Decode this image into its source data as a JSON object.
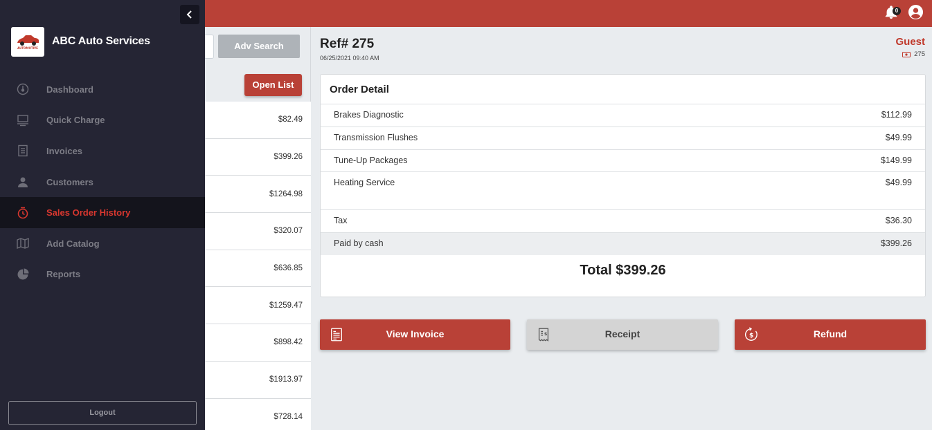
{
  "topbar": {
    "notification_count": "0",
    "bell_icon": "bell-icon",
    "user_icon": "user-circle-icon"
  },
  "list": {
    "adv_search_label": "Adv Search",
    "open_list_label": "Open List",
    "amounts": [
      "$82.49",
      "$399.26",
      "$1264.98",
      "$320.07",
      "$636.85",
      "$1259.47",
      "$898.42",
      "$1913.97",
      "$728.14"
    ]
  },
  "sidebar": {
    "collapse_icon": "chevron-left-icon",
    "brand_name": "ABC Auto Services",
    "logo_text": "AUTOMOTIVE",
    "items": [
      {
        "label": "Dashboard",
        "icon": "gauge-icon"
      },
      {
        "label": "Quick Charge",
        "icon": "register-icon"
      },
      {
        "label": "Invoices",
        "icon": "invoice-icon"
      },
      {
        "label": "Customers",
        "icon": "person-icon"
      },
      {
        "label": "Sales Order History",
        "icon": "history-icon",
        "active": true
      },
      {
        "label": "Add Catalog",
        "icon": "catalog-icon"
      },
      {
        "label": "Reports",
        "icon": "pie-chart-icon"
      }
    ],
    "logout_label": "Logout"
  },
  "order": {
    "ref": "Ref# 275",
    "date": "06/25/2021 09:40 AM",
    "customer": "Guest",
    "customer_id": "275",
    "card_title": "Order Detail",
    "items": [
      {
        "name": "Brakes Diagnostic",
        "amount": "$112.99"
      },
      {
        "name": "Transmission Flushes",
        "amount": "$49.99"
      },
      {
        "name": "Tune-Up Packages",
        "amount": "$149.99"
      },
      {
        "name": "Heating Service",
        "amount": "$49.99"
      }
    ],
    "tax_label": "Tax",
    "tax_amount": "$36.30",
    "paid_label": "Paid by cash",
    "paid_amount": "$399.26",
    "total": "Total $399.26"
  },
  "actions": {
    "view_invoice": "View Invoice",
    "receipt": "Receipt",
    "refund": "Refund"
  },
  "colors": {
    "brand_red": "#b94137",
    "sidebar_bg": "#252534",
    "active_text": "#d9372f"
  }
}
